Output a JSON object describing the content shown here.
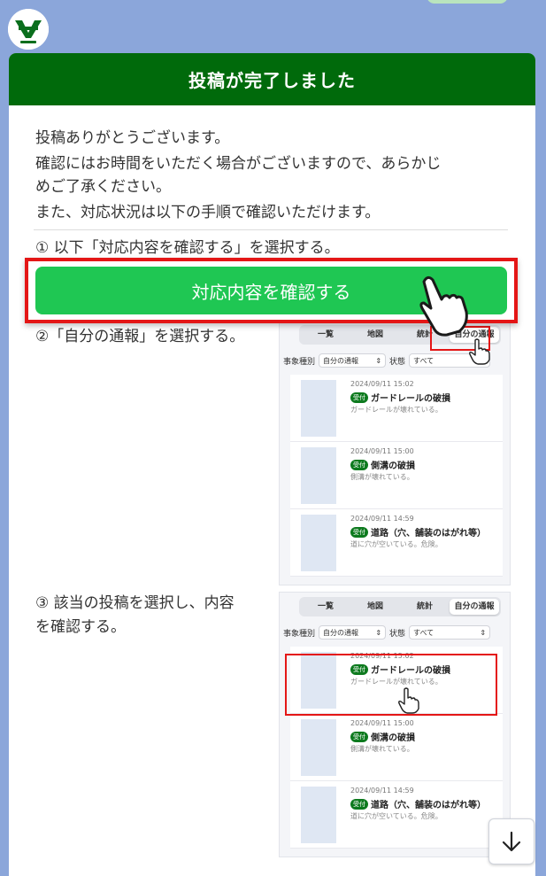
{
  "header": {
    "title": "投稿が完了しました"
  },
  "intro": {
    "line1": "投稿ありがとうございます。",
    "line2a": "確認にはお時間をいただく場合がございますので、あらかじ",
    "line2b": "めご了承ください。",
    "line3": "また、対応状況は以下の手順で確認いただけます。"
  },
  "steps": {
    "step1": "① 以下「対応内容を確認する」を選択する。",
    "step2": "②「自分の通報」を選択する。",
    "step3a": "③ 該当の投稿を選択し、内容",
    "step3b": "を確認する。"
  },
  "cta": {
    "label": "対応内容を確認する"
  },
  "app_preview": {
    "tabs": [
      "一覧",
      "地図",
      "統計",
      "自分の通報"
    ],
    "filter": {
      "type_label": "事象種別",
      "type_value": "自分の通報",
      "status_label": "状態",
      "status_value": "すべて"
    },
    "reports": [
      {
        "time": "2024/09/11 15:02",
        "badge": "受付",
        "title": "ガードレールの破損",
        "desc": "ガードレールが壊れている。"
      },
      {
        "time": "2024/09/11 15:00",
        "badge": "受付",
        "title": "側溝の破損",
        "desc": "側溝が壊れている。"
      },
      {
        "time": "2024/09/11 14:59",
        "badge": "受付",
        "title": "道路（穴、舗装のはがれ等）",
        "desc": "道に穴が空いている。危険。"
      }
    ]
  },
  "colors": {
    "header": "#006a0b",
    "cta": "#1fc753",
    "highlight": "#e41616",
    "background": "#8ba6da"
  },
  "icons": {
    "fab": "arrow-down-icon",
    "pointer": "hand-pointer-icon"
  }
}
